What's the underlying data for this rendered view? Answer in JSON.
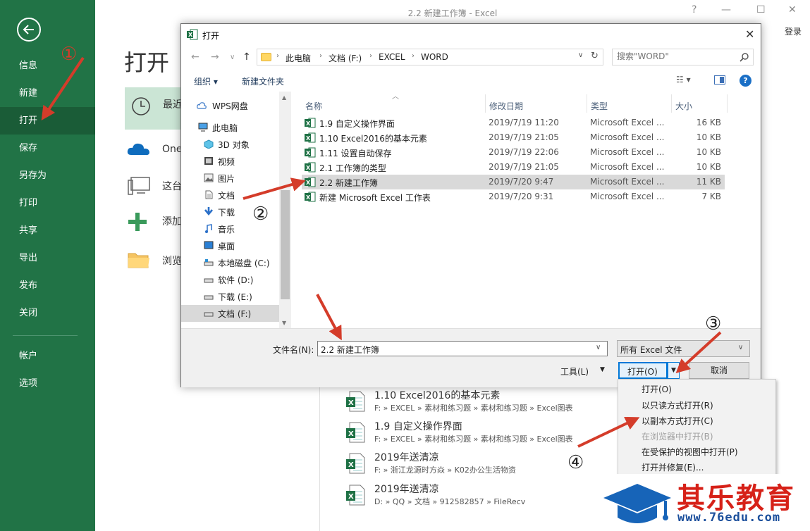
{
  "window": {
    "title": "2.2 新建工作簿 - Excel",
    "help": "?",
    "minimize": "—",
    "maximize": "☐",
    "close": "✕",
    "login": "登录"
  },
  "sidebar": {
    "items": [
      {
        "label": "信息"
      },
      {
        "label": "新建"
      },
      {
        "label": "打开"
      },
      {
        "label": "保存"
      },
      {
        "label": "另存为"
      },
      {
        "label": "打印"
      },
      {
        "label": "共享"
      },
      {
        "label": "导出"
      },
      {
        "label": "发布"
      },
      {
        "label": "关闭"
      },
      {
        "label": "帐户"
      },
      {
        "label": "选项"
      }
    ]
  },
  "backstage": {
    "heading": "打开",
    "places": [
      {
        "label": "最近"
      },
      {
        "label": "One"
      },
      {
        "label": "这台"
      },
      {
        "label": "添加"
      },
      {
        "label": "浏览"
      }
    ],
    "recent": [
      {
        "name": "1.10 Excel2016的基本元素",
        "path": "F: » EXCEL » 素材和练习题 » 素材和练习题 » Excel图表"
      },
      {
        "name": "1.9 自定义操作界面",
        "path": "F: » EXCEL » 素材和练习题 » 素材和练习题 » Excel图表"
      },
      {
        "name": "2019年送清凉",
        "path": "F: » 浙江龙源时方焱 » K02办公生活物资"
      },
      {
        "name": "2019年送清凉",
        "path": "D: » QQ » 文档 » 912582857 » FileRecv"
      }
    ]
  },
  "dialog": {
    "title": "打开",
    "close": "✕",
    "nav": {
      "back": "←",
      "forward": "→",
      "up": "↑",
      "refresh": "↻",
      "dropdown": "∨"
    },
    "breadcrumbs": [
      "此电脑",
      "文档 (F:)",
      "EXCEL",
      "WORD"
    ],
    "search_placeholder": "搜索\"WORD\"",
    "toolbar": {
      "organize": "组织 ▾",
      "new_folder": "新建文件夹",
      "view": "☷ ▾",
      "help": "?"
    },
    "tree": [
      {
        "label": "WPS网盘",
        "icon": "cloud-icon"
      },
      {
        "label": "此电脑",
        "icon": "computer-icon"
      },
      {
        "label": "3D 对象",
        "icon": "cube-icon"
      },
      {
        "label": "视频",
        "icon": "video-icon"
      },
      {
        "label": "图片",
        "icon": "picture-icon"
      },
      {
        "label": "文档",
        "icon": "document-icon"
      },
      {
        "label": "下载",
        "icon": "download-icon"
      },
      {
        "label": "音乐",
        "icon": "music-icon"
      },
      {
        "label": "桌面",
        "icon": "desktop-icon"
      },
      {
        "label": "本地磁盘 (C:)",
        "icon": "drive-icon"
      },
      {
        "label": "软件 (D:)",
        "icon": "drive-icon"
      },
      {
        "label": "下载 (E:)",
        "icon": "drive-icon"
      },
      {
        "label": "文档 (F:)",
        "icon": "drive-icon"
      }
    ],
    "columns": {
      "name": "名称",
      "modified": "修改日期",
      "type": "类型",
      "size": "大小"
    },
    "files": [
      {
        "name": "1.9 自定义操作界面",
        "modified": "2019/7/19 11:20",
        "type": "Microsoft Excel ...",
        "size": "16 KB"
      },
      {
        "name": "1.10 Excel2016的基本元素",
        "modified": "2019/7/19 21:05",
        "type": "Microsoft Excel ...",
        "size": "10 KB"
      },
      {
        "name": "1.11 设置自动保存",
        "modified": "2019/7/19 22:06",
        "type": "Microsoft Excel ...",
        "size": "10 KB"
      },
      {
        "name": "2.1 工作簿的类型",
        "modified": "2019/7/19 21:05",
        "type": "Microsoft Excel ...",
        "size": "10 KB"
      },
      {
        "name": "2.2 新建工作簿",
        "modified": "2019/7/20 9:47",
        "type": "Microsoft Excel ...",
        "size": "11 KB"
      },
      {
        "name": "新建 Microsoft Excel 工作表",
        "modified": "2019/7/20 9:31",
        "type": "Microsoft Excel ...",
        "size": "7 KB"
      }
    ],
    "filename_label": "文件名(N):",
    "filename_value": "2.2 新建工作簿",
    "filetype_value": "所有 Excel 文件",
    "tools_label": "工具(L)",
    "open_label": "打开(O)",
    "cancel_label": "取消"
  },
  "open_menu": {
    "items": [
      {
        "label": "打开(O)",
        "enabled": true
      },
      {
        "label": "以只读方式打开(R)",
        "enabled": true
      },
      {
        "label": "以副本方式打开(C)",
        "enabled": true
      },
      {
        "label": "在浏览器中打开(B)",
        "enabled": false
      },
      {
        "label": "在受保护的视图中打开(P)",
        "enabled": true
      },
      {
        "label": "打开并修复(E)...",
        "enabled": true
      }
    ]
  },
  "annotations": {
    "step1": "①",
    "step2": "②",
    "step3": "③",
    "step4": "④",
    "color": "#d43c2a"
  },
  "watermark": {
    "text": "其乐教育",
    "url": "www.76edu.com"
  },
  "colors": {
    "excel_green": "#217346",
    "selected_row": "#d9d9d9",
    "accent_blue": "#0078d7"
  }
}
